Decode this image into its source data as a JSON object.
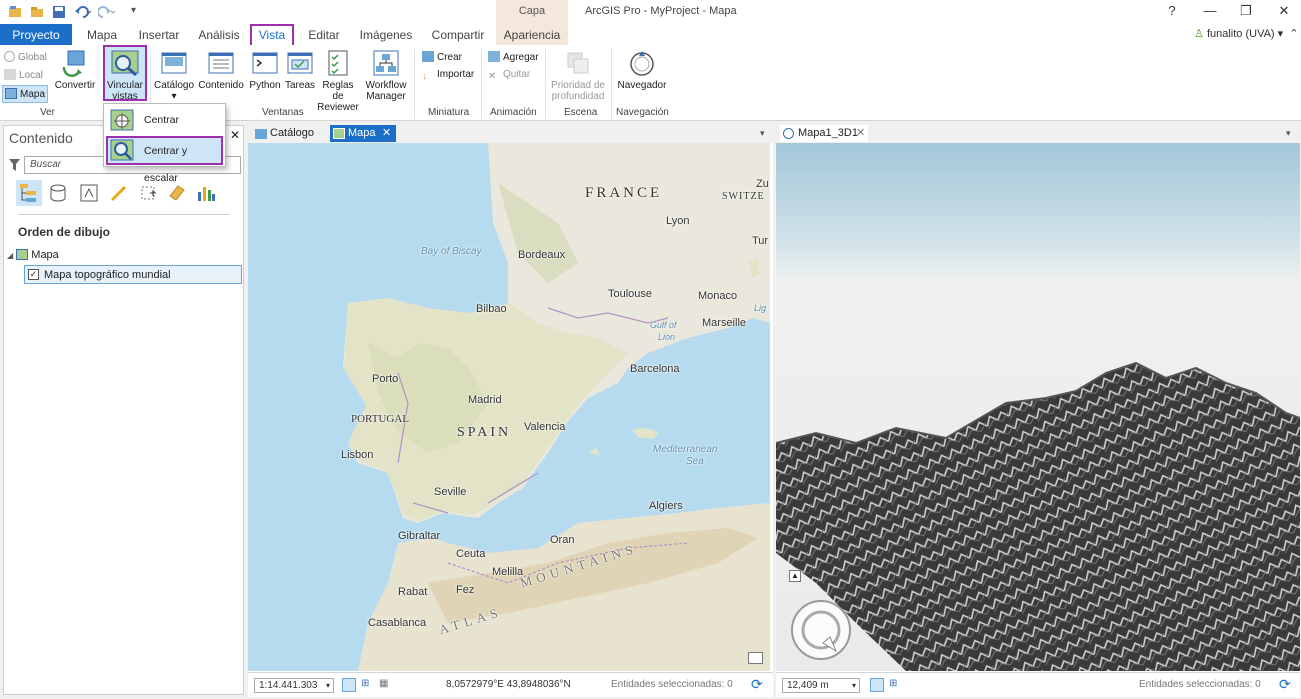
{
  "window": {
    "title": "ArcGIS Pro - MyProject - Mapa",
    "context_group": "Capa"
  },
  "tabs": [
    "Proyecto",
    "Mapa",
    "Insertar",
    "Análisis",
    "Vista",
    "Editar",
    "Imágenes",
    "Compartir",
    "Apariencia"
  ],
  "active_tab": "Vista",
  "user": "funalito (UVA)",
  "ribbon": {
    "ver": {
      "group_label": "Ver",
      "global": "Global",
      "local": "Local",
      "mapa": "Mapa",
      "convertir": "Convertir",
      "vincular": "Vincular vistas"
    },
    "ventanas": {
      "group_label": "Ventanas",
      "catalogo": "Catálogo",
      "contenido": "Contenido",
      "python": "Python",
      "tareas": "Tareas",
      "reglas": "Reglas de Reviewer",
      "workflow": "Workflow Manager"
    },
    "miniatura": {
      "group_label": "Miniatura",
      "crear": "Crear",
      "importar": "Importar"
    },
    "animacion": {
      "group_label": "Animación",
      "agregar": "Agregar",
      "quitar": "Quitar"
    },
    "escena": {
      "group_label": "Escena",
      "prioridad": "Prioridad de profundidad"
    },
    "navegacion": {
      "group_label": "Navegación",
      "navegador": "Navegador"
    }
  },
  "dropdown": {
    "items": [
      "Centrar",
      "Centrar y escalar"
    ]
  },
  "contents": {
    "title": "Contenido",
    "search_placeholder": "Buscar",
    "drawing_order": "Orden de dibujo",
    "map_name": "Mapa",
    "layer": "Mapa topográfico mundial"
  },
  "map_view": {
    "tabs": [
      "Catálogo",
      "Mapa"
    ],
    "scale": "1:14.441.303",
    "coords": "8,0572979°E 43,8948036°N",
    "selected": "Entidades seleccionadas: 0",
    "labels": [
      "FRANCE",
      "Lyon",
      "Bay of Biscay",
      "Bordeaux",
      "Toulouse",
      "Monaco",
      "Marseille",
      "Bilbao",
      "Gulf of",
      "Lion",
      "Barcelona",
      "Porto",
      "Madrid",
      "PORTUGAL",
      "SPAIN",
      "Valencia",
      "Lisbon",
      "Mediterranean",
      "Sea",
      "Seville",
      "Algiers",
      "Gibraltar",
      "Oran",
      "Ceuta",
      "Melilla",
      "Rabat",
      "Fez",
      "Casablanca",
      "ATLAS",
      "MOUNTAINS",
      "Zu",
      "SWITZE",
      "Tur",
      "Lig"
    ]
  },
  "scene_view": {
    "tab": "Mapa1_3D1",
    "distance": "12,409 m",
    "selected": "Entidades seleccionadas: 0"
  },
  "colors": {
    "accent": "#1b6fc9",
    "highlight": "#9b2fae",
    "ribbon_hover": "#cde5f7"
  }
}
